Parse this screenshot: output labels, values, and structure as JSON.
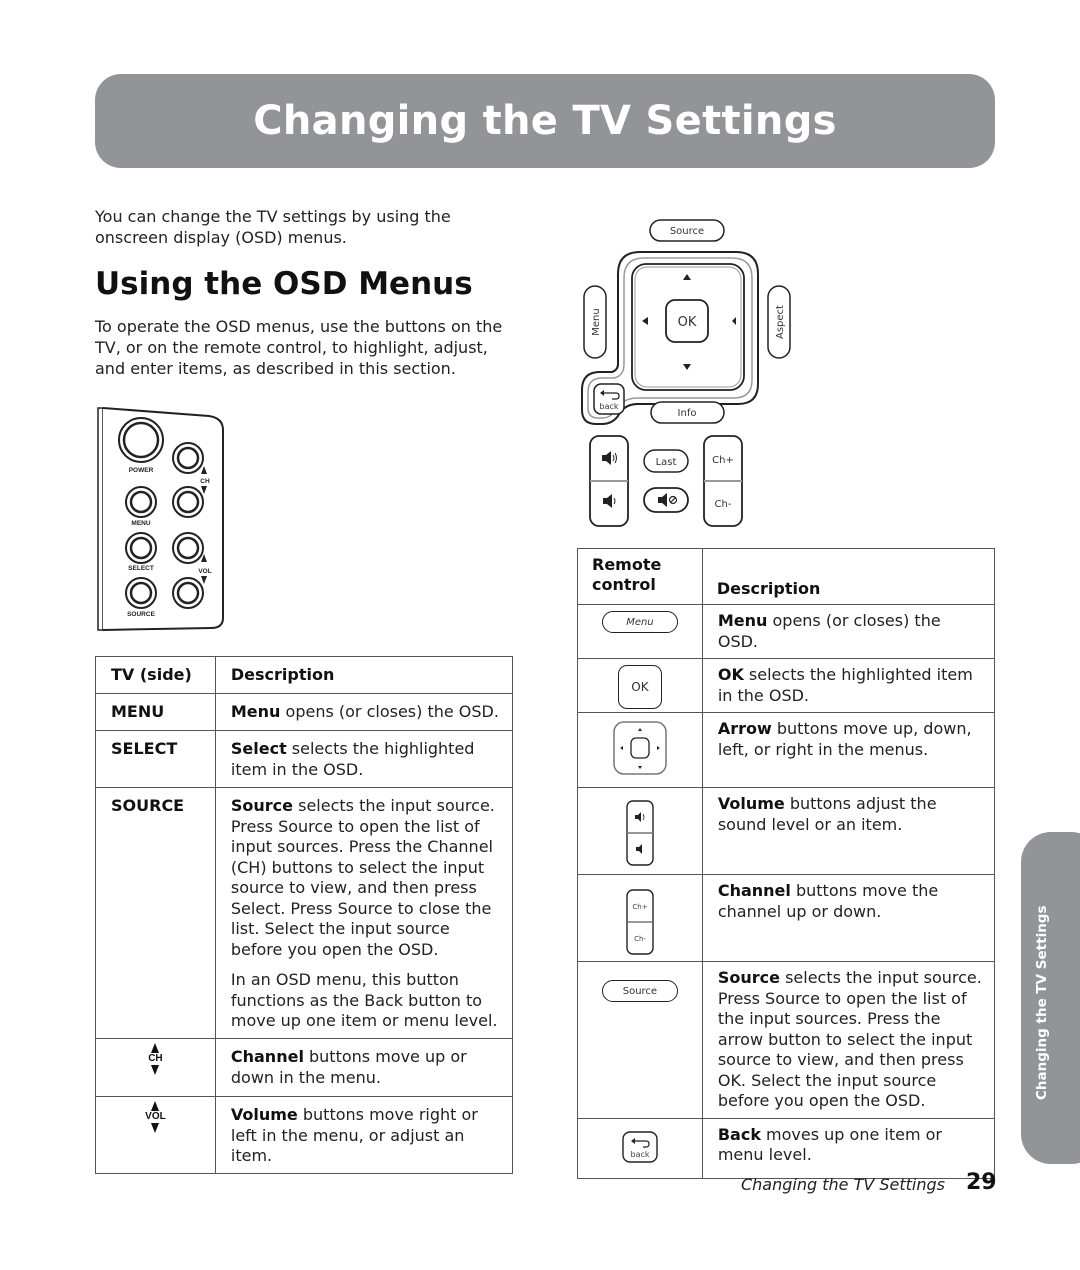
{
  "page": {
    "title": "Changing the TV Settings",
    "intro": "You can change the TV settings by using the onscreen display (OSD) menus.",
    "section_heading": "Using the OSD Menus",
    "section_para": "To operate the OSD menus, use the buttons on the TV, or on the remote control, to highlight, adjust, and enter items, as described in this section.",
    "side_tab": "Changing the TV Settings",
    "footer_title": "Changing the TV Settings",
    "page_number": "29",
    "banner_color": "#929497"
  },
  "tv_panel": {
    "labels": {
      "power": "POWER",
      "ch": "CH",
      "menu": "MENU",
      "select": "SELECT",
      "vol": "VOL",
      "source": "SOURCE"
    }
  },
  "remote": {
    "source": "Source",
    "menu": "Menu",
    "ok": "OK",
    "aspect": "Aspect",
    "back": "back",
    "info": "Info",
    "last": "Last",
    "ch_plus": "Ch+",
    "ch_minus": "Ch-"
  },
  "tv_table": {
    "headers": [
      "TV (side)",
      "Description"
    ],
    "rows": [
      {
        "key": "MENU",
        "bold": "Menu",
        "text": " opens (or closes) the OSD."
      },
      {
        "key": "SELECT",
        "bold": "Select",
        "text": " selects the highlighted item in the OSD."
      },
      {
        "key": "SOURCE",
        "bold": "Source",
        "text": " selects the input source. Press Source to open the list of input sources. Press the Channel (CH) buttons to select the input source to view, and then press Select. Press Source to close the list. Select the input source before you open the OSD.",
        "extra": "In an OSD menu, this button functions as the Back button to move up one item or menu level."
      },
      {
        "key_icon": "ch-updown-icon",
        "key_label": "CH",
        "bold": "Channel",
        "text": " buttons move up or down in the menu."
      },
      {
        "key_icon": "vol-updown-icon",
        "key_label": "VOL",
        "bold": "Volume",
        "text": " buttons move right or left in the menu, or adjust an item."
      }
    ]
  },
  "remote_table": {
    "headers": [
      "Remote control",
      "Description"
    ],
    "rows": [
      {
        "icon": "menu-button-icon",
        "icon_label": "Menu",
        "bold": "Menu",
        "text": " opens (or closes) the OSD."
      },
      {
        "icon": "ok-button-icon",
        "icon_label": "OK",
        "bold": "OK",
        "text": " selects the highlighted item in the OSD."
      },
      {
        "icon": "arrow-pad-icon",
        "bold": "Arrow",
        "text": " buttons move up, down, left, or right in the menus."
      },
      {
        "icon": "volume-buttons-icon",
        "bold": "Volume",
        "text": " buttons adjust the sound level or an item."
      },
      {
        "icon": "channel-buttons-icon",
        "icon_label_top": "Ch+",
        "icon_label_bottom": "Ch-",
        "bold": "Channel",
        "text": " buttons move the channel up or down."
      },
      {
        "icon": "source-button-icon",
        "icon_label": "Source",
        "bold": "Source",
        "text": " selects the input source. Press Source to open the list of the input sources. Press the arrow button to select the input source to view, and then press OK. Select the input source before you open the OSD."
      },
      {
        "icon": "back-button-icon",
        "icon_label": "back",
        "bold": "Back",
        "text": " moves up one item or menu level."
      }
    ]
  }
}
